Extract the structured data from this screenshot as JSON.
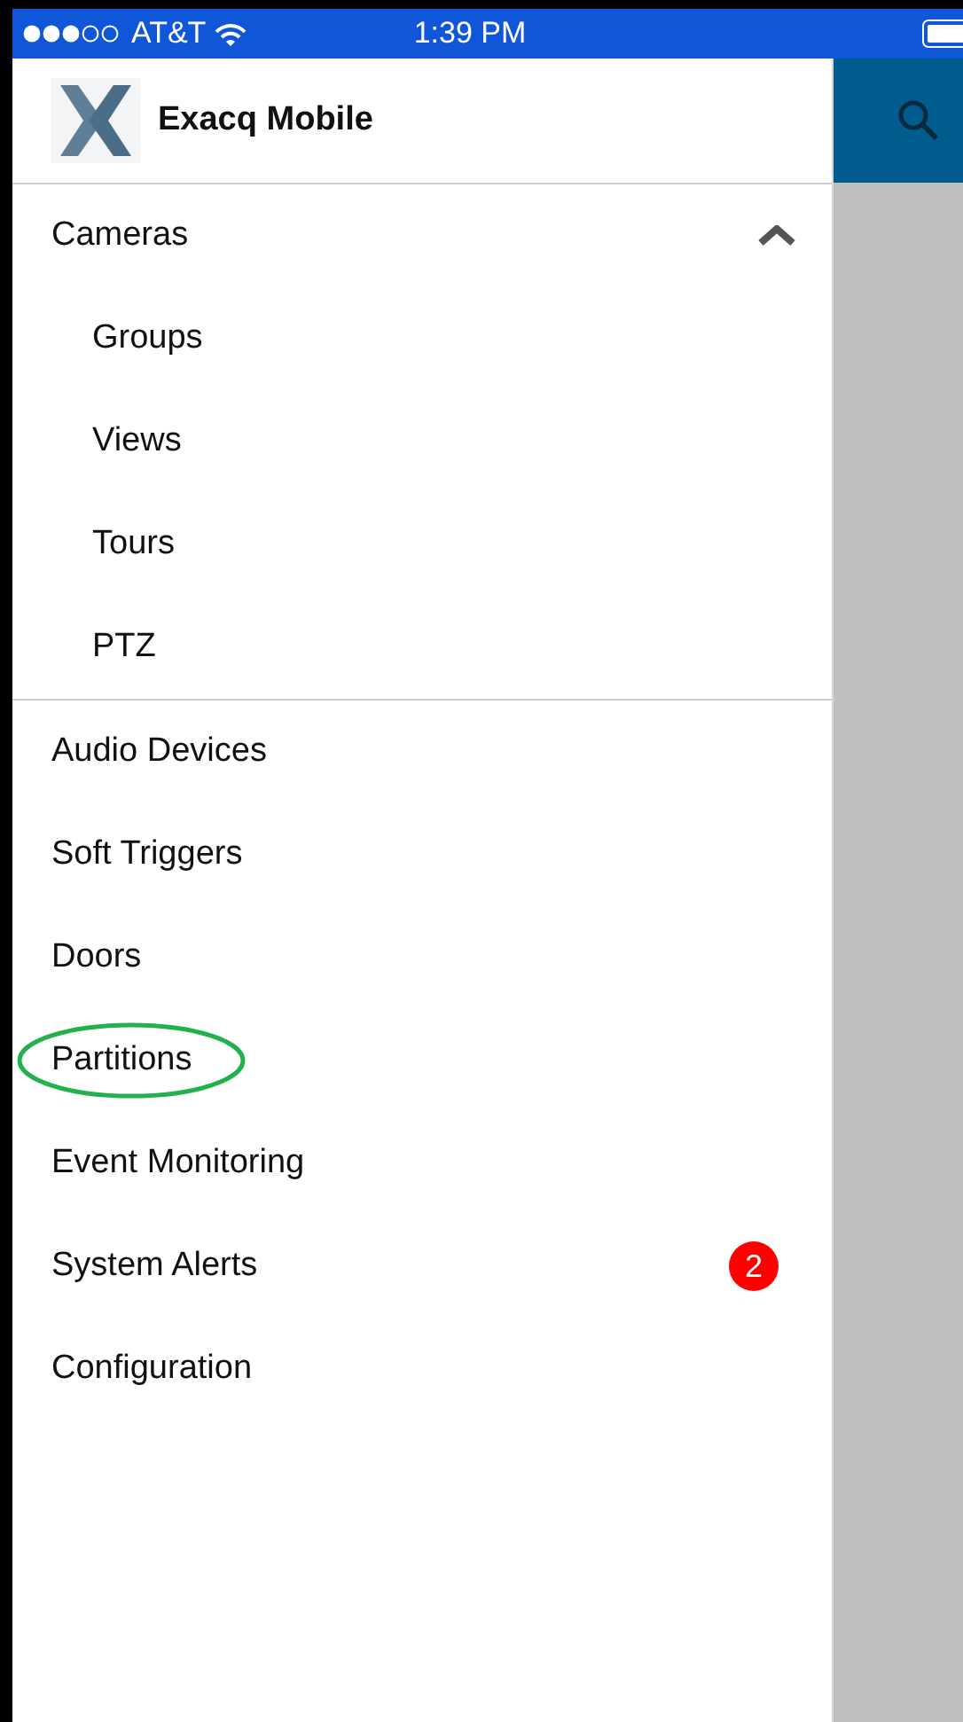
{
  "status_bar": {
    "carrier": "AT&T",
    "time": "1:39 PM"
  },
  "drawer": {
    "title": "Exacq Mobile",
    "items": [
      {
        "label": "Cameras",
        "expanded": true,
        "children": [
          {
            "label": "Groups"
          },
          {
            "label": "Views"
          },
          {
            "label": "Tours"
          },
          {
            "label": "PTZ"
          }
        ]
      },
      {
        "label": "Audio Devices"
      },
      {
        "label": "Soft Triggers"
      },
      {
        "label": "Doors"
      },
      {
        "label": "Partitions",
        "circled": true
      },
      {
        "label": "Event Monitoring"
      },
      {
        "label": "System Alerts",
        "badge": "2"
      },
      {
        "label": "Configuration"
      }
    ]
  }
}
